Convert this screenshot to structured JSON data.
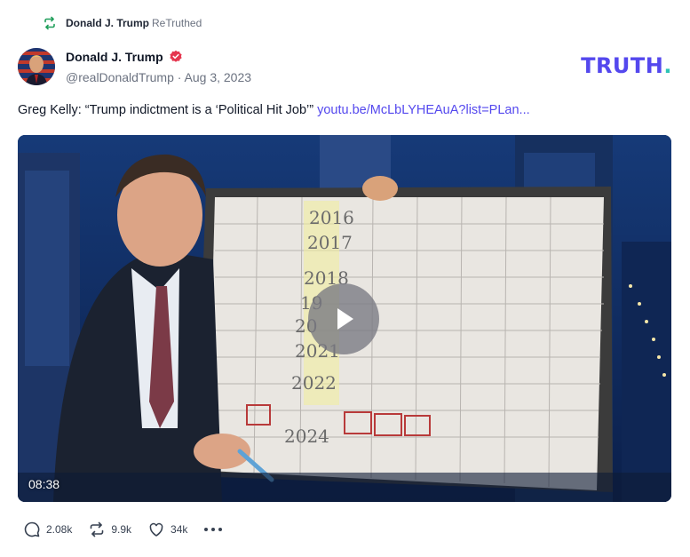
{
  "retruth": {
    "user": "Donald J. Trump",
    "label": "ReTruthed",
    "icon": "retruth-icon"
  },
  "post": {
    "display_name": "Donald J. Trump",
    "handle": "@realDonaldTrump",
    "date": "Aug 3, 2023",
    "meta_sep": " · ",
    "text": "Greg Kelly: “Trump indictment is a ‘Political Hit Job’”",
    "link": "youtu.be/McLbLYHEAuA?list=PLan..."
  },
  "brand": {
    "name": "TRUTH",
    "dot": ".",
    "color": "#5448ee",
    "dot_color": "#2ec4b6"
  },
  "video": {
    "duration": "08:38",
    "board_years": [
      "2016",
      "2017",
      "2018",
      "19",
      "20",
      "2021",
      "2022",
      "2024"
    ]
  },
  "actions": {
    "replies": "2.08k",
    "retruths": "9.9k",
    "likes": "34k"
  }
}
